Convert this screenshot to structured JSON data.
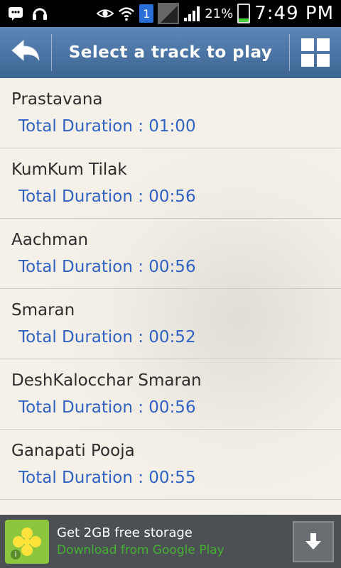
{
  "status_bar": {
    "battery_percent": "21%",
    "time": "7:49 PM",
    "sim_label": "1",
    "icons": [
      "bbm-icon",
      "headset-icon",
      "eye-icon",
      "wifi-icon",
      "sim-icon",
      "signal-icon",
      "battery-icon"
    ]
  },
  "header": {
    "title": "Select a track to play",
    "back_icon": "back-arrow-icon",
    "grid_icon": "grid-icon"
  },
  "tracks": [
    {
      "name": "Prastavana",
      "duration": "Total Duration : 01:00"
    },
    {
      "name": "KumKum Tilak",
      "duration": "Total Duration : 00:56"
    },
    {
      "name": "Aachman",
      "duration": "Total Duration : 00:56"
    },
    {
      "name": "Smaran",
      "duration": "Total Duration : 00:52"
    },
    {
      "name": "DeshKalocchar Smaran",
      "duration": "Total Duration : 00:56"
    },
    {
      "name": "Ganapati Pooja",
      "duration": "Total Duration : 00:55"
    }
  ],
  "ad": {
    "line1": "Get 2GB free storage",
    "line2": "Download from Google Play",
    "info_label": "i"
  },
  "colors": {
    "header": "#4a73a4",
    "duration_text": "#2f62c2",
    "ad_green": "#44b233",
    "ad_icon_bg": "#8cc63f"
  }
}
